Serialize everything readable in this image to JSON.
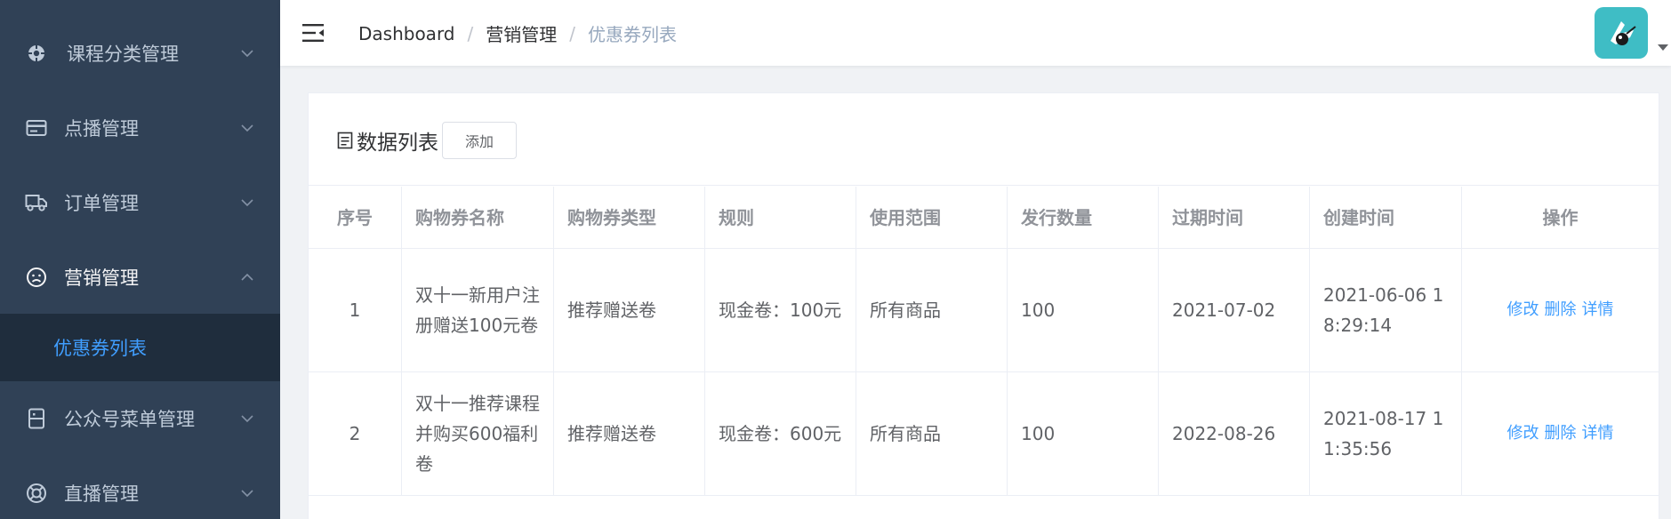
{
  "sidebar": {
    "items": [
      {
        "label": "课程分类管理",
        "icon": "settings-icon",
        "expanded": false
      },
      {
        "label": "点播管理",
        "icon": "card-icon",
        "expanded": false
      },
      {
        "label": "订单管理",
        "icon": "truck-icon",
        "expanded": false
      },
      {
        "label": "营销管理",
        "icon": "face-icon",
        "expanded": true
      },
      {
        "label": "公众号菜单管理",
        "icon": "phone-icon",
        "expanded": false
      },
      {
        "label": "直播管理",
        "icon": "lifebuoy-icon",
        "expanded": false
      }
    ],
    "active_sub": "优惠券列表"
  },
  "navbar": {
    "breadcrumb": [
      "Dashboard",
      "营销管理",
      "优惠券列表"
    ],
    "separator": "/"
  },
  "card": {
    "title": "数据列表",
    "add_label": "添加"
  },
  "table": {
    "headers": [
      "序号",
      "购物券名称",
      "购物券类型",
      "规则",
      "使用范围",
      "发行数量",
      "过期时间",
      "创建时间",
      "操作"
    ],
    "rows": [
      {
        "index": "1",
        "name": "双十一新用户注册赠送100元卷",
        "type": "推荐赠送卷",
        "rule": "现金卷：100元",
        "scope": "所有商品",
        "count": "100",
        "expire": "2021-07-02",
        "created": "2021-06-06 18:29:14",
        "ops": [
          "修改",
          "删除",
          "详情"
        ]
      },
      {
        "index": "2",
        "name": "双十一推荐课程并购买600福利卷",
        "type": "推荐赠送卷",
        "rule": "现金卷：600元",
        "scope": "所有商品",
        "count": "100",
        "expire": "2022-08-26",
        "created": "2021-08-17 11:35:56",
        "ops": [
          "修改",
          "删除",
          "详情"
        ]
      }
    ]
  },
  "colors": {
    "sidebar_bg": "#304156",
    "submenu_bg": "#1f2d3d",
    "accent": "#409eff",
    "avatar_bg": "#3fbdc5"
  }
}
